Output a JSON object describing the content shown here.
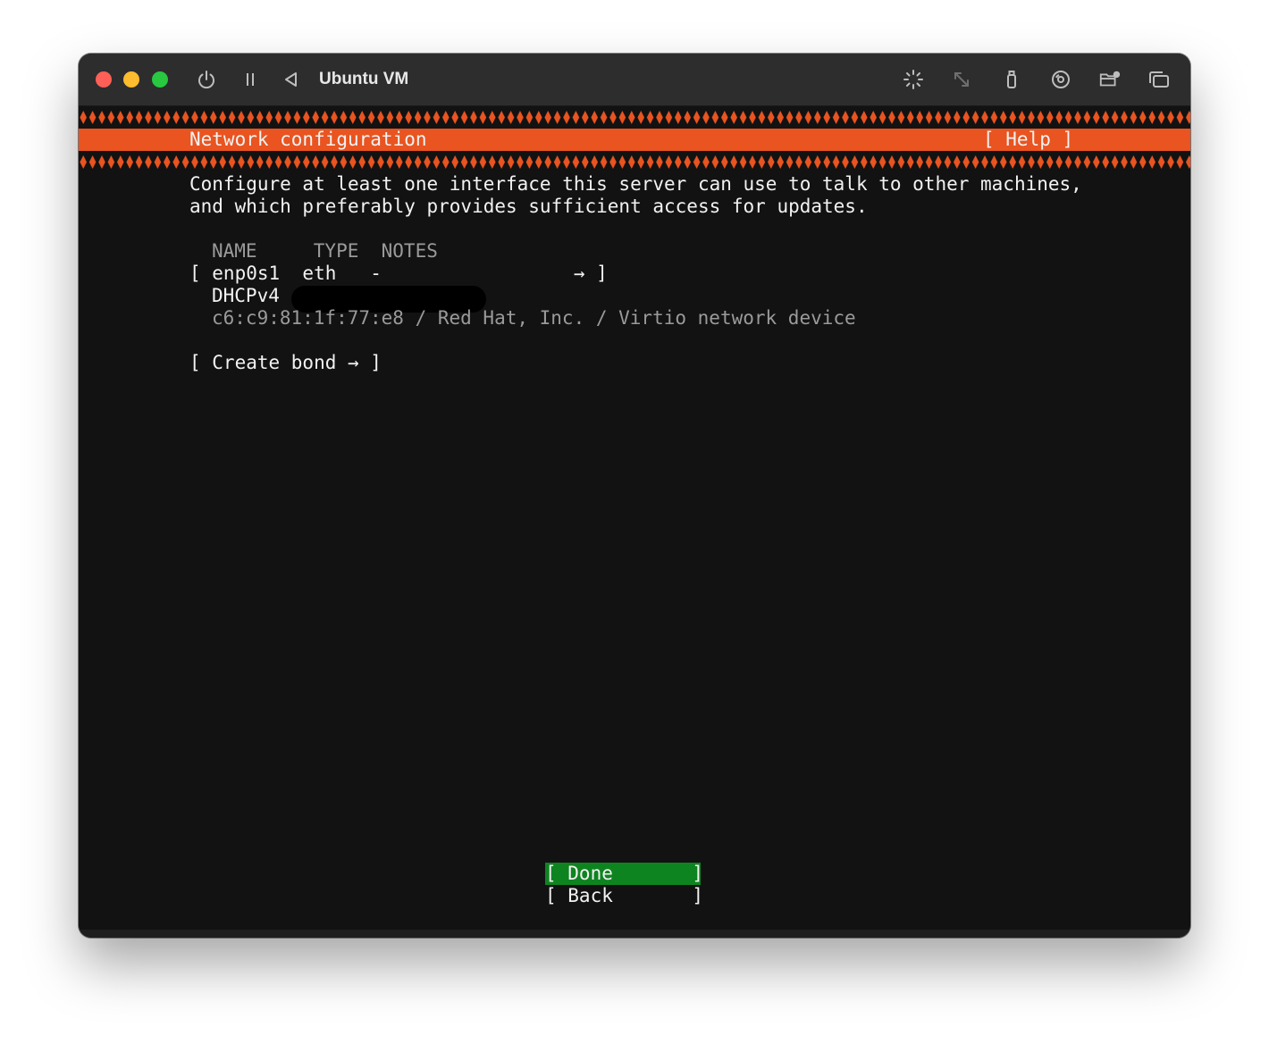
{
  "window": {
    "title": "Ubuntu VM",
    "toolbar_icons": [
      "power-icon",
      "pause-icon",
      "back-icon",
      "brightness-icon",
      "resize-icon",
      "usb-icon",
      "disc-icon",
      "shared-folder-icon",
      "window-icon"
    ]
  },
  "colors": {
    "accent": "#e95420",
    "focus": "#0e8420",
    "terminal_bg": "#121212"
  },
  "header": {
    "title": "Network configuration",
    "help": "[ Help ]"
  },
  "intro": {
    "line1": "Configure at least one interface this server can use to talk to other machines,",
    "line2": "and which preferably provides sufficient access for updates."
  },
  "table": {
    "header": "NAME     TYPE  NOTES",
    "interface_row": "[ enp0s1  eth   -                 → ]",
    "dhcp_label": "DHCPv4",
    "device_info": "c6:c9:81:1f:77:e8 / Red Hat, Inc. / Virtio network device"
  },
  "create_bond": "[ Create bond → ]",
  "buttons": {
    "done": "[ Done       ]",
    "back": "[ Back       ]"
  }
}
